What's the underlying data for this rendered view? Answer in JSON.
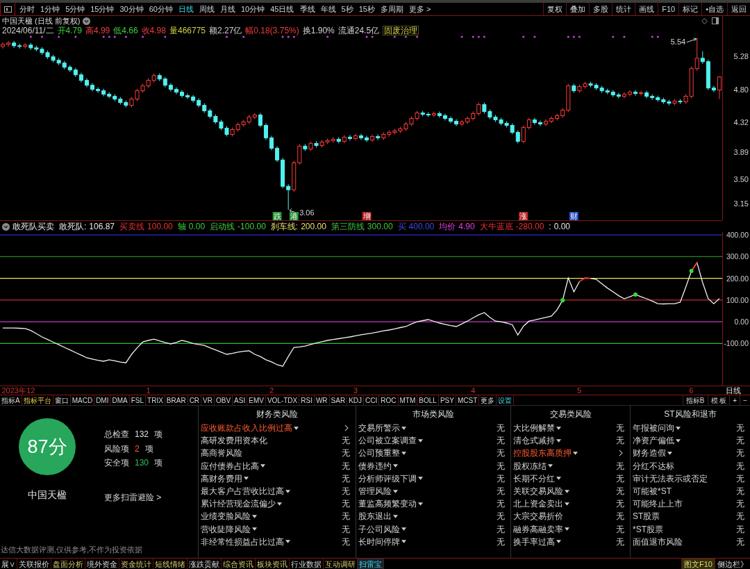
{
  "toolbar": {
    "periods": [
      {
        "label": "分时",
        "selected": false
      },
      {
        "label": "1分钟",
        "selected": false
      },
      {
        "label": "5分钟",
        "selected": false
      },
      {
        "label": "15分钟",
        "selected": false
      },
      {
        "label": "30分钟",
        "selected": false
      },
      {
        "label": "60分钟",
        "selected": false
      },
      {
        "label": "日线",
        "selected": true
      },
      {
        "label": "周线",
        "selected": false
      },
      {
        "label": "月线",
        "selected": false
      },
      {
        "label": "10分钟",
        "selected": false
      },
      {
        "label": "45日线",
        "selected": false
      },
      {
        "label": "季线",
        "selected": false
      },
      {
        "label": "年线",
        "selected": false
      },
      {
        "label": "5秒",
        "selected": false
      },
      {
        "label": "15秒",
        "selected": false
      },
      {
        "label": "多周期",
        "selected": false
      }
    ],
    "more": "更多 >",
    "actions": [
      "复权",
      "叠加",
      "多股",
      "统计",
      "画线",
      "F10",
      "标记",
      "•自选",
      "返回"
    ]
  },
  "chart_header": {
    "title": "中国天楹 (日线 前复权)",
    "date": "2024/06/11/二",
    "quote": [
      {
        "text": "开4.79",
        "color": "#3cd23c"
      },
      {
        "text": "高4.99",
        "color": "#f03a3a"
      },
      {
        "text": "低4.66",
        "color": "#3cd23c"
      },
      {
        "text": "收4.98",
        "color": "#f03a3a"
      },
      {
        "text": "量466775",
        "color": "#cfcf48"
      },
      {
        "text": "额2.27亿",
        "color": "#d4d4d4"
      },
      {
        "text": "幅0.18(3.75%)",
        "color": "#f03a3a"
      },
      {
        "text": "换1.90%",
        "color": "#d4d4d4"
      },
      {
        "text": "流通24.5亿",
        "color": "#d4d4d4"
      }
    ],
    "concept": "固废治理"
  },
  "price_pane": {
    "event_tags": [
      {
        "label": "跌",
        "color": "#1f8f2f"
      },
      {
        "label": "港",
        "color": "#1f8f2f"
      },
      {
        "label": "增",
        "color": "#b82020"
      },
      {
        "label": "涨",
        "color": "#b82020"
      },
      {
        "label": "财",
        "color": "#2850c8"
      }
    ],
    "chart_data": {
      "type": "candlestick",
      "tick_labels": "y",
      "categories": [
        null,
        null,
        null,
        null,
        null,
        null,
        null,
        null,
        null,
        null,
        null,
        null,
        null,
        null,
        null,
        null,
        null,
        null,
        null,
        null,
        null,
        null,
        null,
        null,
        null,
        null,
        null,
        null,
        null,
        null,
        null,
        null,
        null,
        null,
        null,
        null,
        null,
        null,
        null,
        null,
        null,
        null,
        null,
        null,
        null,
        null,
        null,
        null,
        null,
        null,
        null,
        null,
        null,
        null,
        null,
        null,
        null,
        null,
        null,
        null,
        null,
        null,
        null,
        null,
        null,
        null,
        null,
        null,
        null,
        null,
        null,
        null,
        null,
        null,
        null,
        null,
        null,
        null,
        null,
        null,
        null,
        null,
        null,
        null,
        null,
        null,
        null,
        null,
        null,
        null,
        null,
        null,
        null,
        null,
        null,
        null,
        null,
        null,
        null,
        null,
        null,
        null,
        null,
        null,
        null,
        null,
        null,
        null,
        null,
        null,
        null,
        null,
        null,
        null,
        null,
        null,
        null,
        null,
        null,
        null,
        null,
        null,
        null,
        null,
        null,
        null,
        null,
        null,
        null
      ],
      "ohlc": [
        [
          5.42,
          5.48,
          5.39,
          5.45
        ],
        [
          5.45,
          5.5,
          5.42,
          5.47
        ],
        [
          5.47,
          5.5,
          5.4,
          5.43
        ],
        [
          5.43,
          5.46,
          5.39,
          5.42
        ],
        [
          5.42,
          5.47,
          5.39,
          5.44
        ],
        [
          5.44,
          5.47,
          5.37,
          5.4
        ],
        [
          5.4,
          5.43,
          5.35,
          5.38
        ],
        [
          5.38,
          5.41,
          5.3,
          5.33
        ],
        [
          5.33,
          5.36,
          5.24,
          5.27
        ],
        [
          5.27,
          5.3,
          5.19,
          5.22
        ],
        [
          5.22,
          5.25,
          5.15,
          5.18
        ],
        [
          5.18,
          5.21,
          5.09,
          5.12
        ],
        [
          5.12,
          5.15,
          5.05,
          5.08
        ],
        [
          5.08,
          5.11,
          4.98,
          5.01
        ],
        [
          5.01,
          5.04,
          4.9,
          4.93
        ],
        [
          4.93,
          4.96,
          4.83,
          4.86
        ],
        [
          4.86,
          4.89,
          4.77,
          4.8
        ],
        [
          4.8,
          4.83,
          4.75,
          4.78
        ],
        [
          4.78,
          4.81,
          4.7,
          4.73
        ],
        [
          4.73,
          4.76,
          4.67,
          4.7
        ],
        [
          4.7,
          4.73,
          4.63,
          4.66
        ],
        [
          4.66,
          4.69,
          4.58,
          4.61
        ],
        [
          4.61,
          4.64,
          4.54,
          4.57
        ],
        [
          4.57,
          4.69,
          4.54,
          4.66
        ],
        [
          4.66,
          4.81,
          4.63,
          4.78
        ],
        [
          4.78,
          4.88,
          4.75,
          4.85
        ],
        [
          4.85,
          4.96,
          4.82,
          4.93
        ],
        [
          4.93,
          5.03,
          4.9,
          5.0
        ],
        [
          5.0,
          5.03,
          4.92,
          4.95
        ],
        [
          4.95,
          4.98,
          4.83,
          4.86
        ],
        [
          4.86,
          4.89,
          4.77,
          4.8
        ],
        [
          4.8,
          4.83,
          4.73,
          4.76
        ],
        [
          4.76,
          4.79,
          4.68,
          4.71
        ],
        [
          4.71,
          4.74,
          4.66,
          4.69
        ],
        [
          4.69,
          4.72,
          4.61,
          4.64
        ],
        [
          4.64,
          4.67,
          4.54,
          4.57
        ],
        [
          4.57,
          4.6,
          4.46,
          4.49
        ],
        [
          4.49,
          4.52,
          4.38,
          4.41
        ],
        [
          4.41,
          4.44,
          4.3,
          4.33
        ],
        [
          4.33,
          4.36,
          4.21,
          4.24
        ],
        [
          4.24,
          4.27,
          4.12,
          4.15
        ],
        [
          4.15,
          4.25,
          4.12,
          4.22
        ],
        [
          4.22,
          4.32,
          4.19,
          4.29
        ],
        [
          4.29,
          4.36,
          4.26,
          4.33
        ],
        [
          4.33,
          4.43,
          4.3,
          4.4
        ],
        [
          4.4,
          4.46,
          4.37,
          4.43
        ],
        [
          4.43,
          4.46,
          4.25,
          4.28
        ],
        [
          4.28,
          4.31,
          4.07,
          4.1
        ],
        [
          4.1,
          4.13,
          3.92,
          3.95
        ],
        [
          3.95,
          3.98,
          3.75,
          3.78
        ],
        [
          3.78,
          3.81,
          3.37,
          3.4
        ],
        [
          3.4,
          3.43,
          3.06,
          3.35
        ],
        [
          3.35,
          3.77,
          3.32,
          3.74
        ],
        [
          3.74,
          4.01,
          3.71,
          3.98
        ],
        [
          3.98,
          4.01,
          3.91,
          3.94
        ],
        [
          3.94,
          4.05,
          3.91,
          4.02
        ],
        [
          4.02,
          4.05,
          3.96,
          3.99
        ],
        [
          3.99,
          4.07,
          3.96,
          4.04
        ],
        [
          4.04,
          4.09,
          4.01,
          4.06
        ],
        [
          4.06,
          4.11,
          4.03,
          4.08
        ],
        [
          4.08,
          4.11,
          4.02,
          4.05
        ],
        [
          4.05,
          4.14,
          4.02,
          4.11
        ],
        [
          4.11,
          4.14,
          4.06,
          4.09
        ],
        [
          4.09,
          4.16,
          4.06,
          4.13
        ],
        [
          4.13,
          4.16,
          4.07,
          4.1
        ],
        [
          4.1,
          4.13,
          4.04,
          4.07
        ],
        [
          4.07,
          4.15,
          4.04,
          4.12
        ],
        [
          4.12,
          4.15,
          4.07,
          4.1
        ],
        [
          4.1,
          4.18,
          4.07,
          4.15
        ],
        [
          4.15,
          4.21,
          4.12,
          4.18
        ],
        [
          4.18,
          4.23,
          4.15,
          4.2
        ],
        [
          4.2,
          4.26,
          4.17,
          4.23
        ],
        [
          4.23,
          4.33,
          4.2,
          4.3
        ],
        [
          4.3,
          4.41,
          4.27,
          4.38
        ],
        [
          4.38,
          4.49,
          4.35,
          4.46
        ],
        [
          4.46,
          4.49,
          4.41,
          4.44
        ],
        [
          4.44,
          4.47,
          4.4,
          4.43
        ],
        [
          4.43,
          4.48,
          4.4,
          4.45
        ],
        [
          4.45,
          4.48,
          4.39,
          4.42
        ],
        [
          4.42,
          4.45,
          4.35,
          4.38
        ],
        [
          4.38,
          4.41,
          4.31,
          4.34
        ],
        [
          4.34,
          4.37,
          4.27,
          4.3
        ],
        [
          4.3,
          4.36,
          4.27,
          4.33
        ],
        [
          4.33,
          4.41,
          4.3,
          4.38
        ],
        [
          4.38,
          4.48,
          4.35,
          4.45
        ],
        [
          4.45,
          4.61,
          4.42,
          4.58
        ],
        [
          4.58,
          4.61,
          4.45,
          4.48
        ],
        [
          4.48,
          4.51,
          4.37,
          4.4
        ],
        [
          4.4,
          4.43,
          4.33,
          4.36
        ],
        [
          4.36,
          4.39,
          4.28,
          4.31
        ],
        [
          4.31,
          4.34,
          4.25,
          4.28
        ],
        [
          4.28,
          4.31,
          4.15,
          4.18
        ],
        [
          4.18,
          4.21,
          4.02,
          4.05
        ],
        [
          4.05,
          4.28,
          4.02,
          4.25
        ],
        [
          4.25,
          4.39,
          4.22,
          4.36
        ],
        [
          4.36,
          4.39,
          4.29,
          4.32
        ],
        [
          4.32,
          4.35,
          4.27,
          4.3
        ],
        [
          4.3,
          4.37,
          4.27,
          4.34
        ],
        [
          4.34,
          4.41,
          4.31,
          4.38
        ],
        [
          4.38,
          4.45,
          4.35,
          4.42
        ],
        [
          4.42,
          4.53,
          4.39,
          4.5
        ],
        [
          4.5,
          4.88,
          4.47,
          4.85
        ],
        [
          4.85,
          4.88,
          4.75,
          4.78
        ],
        [
          4.78,
          4.87,
          4.75,
          4.84
        ],
        [
          4.84,
          4.91,
          4.81,
          4.88
        ],
        [
          4.88,
          4.91,
          4.83,
          4.86
        ],
        [
          4.86,
          4.89,
          4.79,
          4.82
        ],
        [
          4.82,
          4.85,
          4.75,
          4.78
        ],
        [
          4.78,
          4.81,
          4.73,
          4.76
        ],
        [
          4.76,
          4.79,
          4.69,
          4.72
        ],
        [
          4.72,
          4.75,
          4.67,
          4.7
        ],
        [
          4.7,
          4.76,
          4.67,
          4.73
        ],
        [
          4.73,
          4.79,
          4.7,
          4.76
        ],
        [
          4.76,
          4.79,
          4.71,
          4.74
        ],
        [
          4.74,
          4.78,
          4.71,
          4.75
        ],
        [
          4.75,
          4.78,
          4.67,
          4.7
        ],
        [
          4.7,
          4.73,
          4.65,
          4.68
        ],
        [
          4.68,
          4.71,
          4.62,
          4.65
        ],
        [
          4.65,
          4.68,
          4.59,
          4.62
        ],
        [
          4.62,
          4.65,
          4.57,
          4.6
        ],
        [
          4.6,
          4.66,
          4.57,
          4.63
        ],
        [
          4.63,
          4.66,
          4.59,
          4.62
        ],
        [
          4.62,
          4.73,
          4.59,
          4.7
        ],
        [
          4.7,
          5.13,
          4.67,
          5.1
        ],
        [
          5.1,
          5.54,
          5.07,
          5.25
        ],
        [
          5.25,
          5.35,
          5.17,
          5.2
        ],
        [
          5.2,
          5.23,
          4.79,
          4.82
        ],
        [
          4.82,
          4.85,
          4.76,
          4.79
        ],
        [
          4.79,
          4.99,
          4.66,
          4.98
        ]
      ],
      "ylim": [
        2.91,
        5.86
      ],
      "yticks": [
        {
          "value": 5.28,
          "label": "5.28"
        },
        {
          "value": 4.8,
          "label": "4.80"
        },
        {
          "value": 4.32,
          "label": "4.32"
        },
        {
          "value": 3.89,
          "label": "3.89"
        },
        {
          "value": 3.5,
          "label": "3.50"
        },
        {
          "value": 3.15,
          "label": "3.15"
        }
      ],
      "annotations": [
        "5.54",
        "3.06"
      ]
    }
  },
  "indicator_pane": {
    "name": "敢死队买卖",
    "legend": [
      {
        "label": "敢死队:",
        "value": "106.87",
        "color": "#e6e6e6"
      },
      {
        "label": "买卖线",
        "value": "100.00",
        "color": "#e83232"
      },
      {
        "label": "轴",
        "value": "0.00",
        "color": "#3cd03c"
      },
      {
        "label": "启动线",
        "value": "-100.00",
        "color": "#3cd03c"
      },
      {
        "label": "刹车线:",
        "value": "200.00",
        "color": "#e8e070"
      },
      {
        "label": "第三防线",
        "value": "300.00",
        "color": "#3cc83c"
      },
      {
        "label": "买",
        "value": "400.00",
        "color": "#3a48e8"
      },
      {
        "label": "均价",
        "value": "4.90",
        "color": "#e040e0"
      },
      {
        "label": "大牛蓝底",
        "value": "-280.00",
        "color": "#e83232"
      },
      {
        "label": ":",
        "value": "0.00",
        "color": "#e6e6e6"
      }
    ],
    "chart_data": {
      "type": "line",
      "categories": [
        null,
        null,
        "2023年",
        null,
        null,
        "12",
        null,
        null,
        null,
        null,
        null,
        null,
        null,
        null,
        null,
        null,
        null,
        null,
        null,
        null,
        null,
        null,
        null,
        null,
        null,
        null,
        "1",
        null,
        null,
        null,
        null,
        null,
        null,
        null,
        null,
        null,
        null,
        null,
        null,
        null,
        null,
        null,
        null,
        null,
        null,
        null,
        null,
        null,
        "2",
        null,
        null,
        null,
        null,
        null,
        null,
        null,
        null,
        null,
        null,
        null,
        null,
        null,
        null,
        "3",
        null,
        null,
        null,
        null,
        null,
        null,
        null,
        null,
        null,
        null,
        null,
        null,
        null,
        null,
        null,
        null,
        null,
        null,
        null,
        null,
        "4",
        null,
        null,
        null,
        null,
        null,
        null,
        null,
        null,
        null,
        null,
        null,
        null,
        null,
        null,
        null,
        null,
        null,
        null,
        "5",
        null,
        null,
        null,
        null,
        null,
        null,
        null,
        null,
        null,
        null,
        null,
        null,
        null,
        null,
        null,
        null,
        null,
        null,
        null,
        "6",
        null,
        null,
        null,
        null,
        null
      ],
      "series": [
        {
          "color": "#f2f2f2",
          "values": [
            -29,
            -29,
            -29,
            -30,
            -31,
            -40,
            -55,
            -70,
            -82,
            -94,
            -106,
            -118,
            -130,
            -142,
            -154,
            -166,
            -172,
            -178,
            -182,
            -175,
            -180,
            -186,
            -189,
            -150,
            -120,
            -93,
            -86,
            -80,
            -88,
            -96,
            -102,
            -95,
            -86,
            -92,
            -100,
            -105,
            -109,
            -120,
            -130,
            -140,
            -150,
            -146,
            -140,
            -136,
            -134,
            -150,
            -160,
            -175,
            -185,
            -198,
            -205,
            -160,
            -118,
            -116,
            -112,
            -105,
            -98,
            -92,
            -86,
            -82,
            -78,
            -74,
            -70,
            -65,
            -60,
            -56,
            -52,
            -47,
            -42,
            -38,
            -33,
            -27,
            -22,
            -10,
            0,
            5,
            10,
            2,
            -6,
            -12,
            -18,
            -22,
            -10,
            3,
            18,
            32,
            42,
            20,
            3,
            0,
            -6,
            -14,
            -61,
            -20,
            3,
            8,
            14,
            20,
            26,
            55,
            99,
            202,
            138,
            185,
            null,
            200,
            195,
            175,
            155,
            138,
            120,
            106,
            115,
            125,
            115,
            106,
            95,
            83,
            82,
            83,
            83,
            90,
            160,
            234,
            272,
            180,
            106,
            83,
            107
          ]
        },
        {
          "type": "line",
          "color": "#ff3030",
          "values": [
            null,
            null,
            null,
            null,
            null,
            null,
            null,
            null,
            null,
            null,
            null,
            null,
            null,
            null,
            null,
            null,
            null,
            null,
            null,
            null,
            null,
            null,
            null,
            null,
            null,
            null,
            null,
            null,
            null,
            null,
            null,
            null,
            null,
            null,
            null,
            null,
            null,
            null,
            null,
            null,
            null,
            null,
            null,
            null,
            null,
            null,
            null,
            null,
            null,
            null,
            null,
            null,
            null,
            null,
            null,
            null,
            null,
            null,
            null,
            null,
            null,
            null,
            null,
            null,
            null,
            null,
            null,
            null,
            null,
            null,
            null,
            null,
            null,
            null,
            null,
            null,
            null,
            null,
            null,
            null,
            null,
            null,
            null,
            null,
            null,
            null,
            null,
            null,
            null,
            null,
            null,
            null,
            null,
            null,
            null,
            null,
            null,
            null,
            null,
            null,
            null,
            null,
            null,
            185,
            202,
            200,
            null,
            null,
            null,
            null,
            null,
            null,
            null,
            null,
            null,
            null,
            null,
            null,
            null,
            null,
            null,
            null,
            null,
            234,
            272,
            null,
            null,
            null,
            null
          ]
        },
        {
          "type": "scatter",
          "color": "#33dd33",
          "values": [
            null,
            null,
            null,
            null,
            null,
            null,
            null,
            null,
            null,
            null,
            null,
            null,
            null,
            null,
            null,
            null,
            null,
            null,
            null,
            null,
            null,
            null,
            null,
            null,
            null,
            null,
            null,
            null,
            null,
            null,
            null,
            null,
            null,
            null,
            null,
            null,
            null,
            null,
            null,
            null,
            null,
            null,
            null,
            null,
            null,
            null,
            null,
            null,
            null,
            null,
            null,
            null,
            null,
            null,
            null,
            null,
            null,
            null,
            null,
            null,
            null,
            null,
            null,
            null,
            null,
            null,
            null,
            null,
            null,
            null,
            null,
            null,
            null,
            null,
            null,
            null,
            null,
            null,
            null,
            null,
            null,
            null,
            null,
            null,
            null,
            null,
            null,
            null,
            null,
            null,
            null,
            null,
            null,
            null,
            null,
            null,
            null,
            null,
            null,
            null,
            99,
            null,
            null,
            null,
            null,
            null,
            null,
            null,
            null,
            null,
            null,
            null,
            null,
            125,
            null,
            null,
            null,
            null,
            null,
            null,
            null,
            null,
            null,
            234,
            null,
            null,
            null,
            null,
            null
          ]
        }
      ],
      "ylim": [
        -294,
        413
      ],
      "yticks": [
        {
          "value": 400,
          "label": "400.00"
        },
        {
          "value": 300,
          "label": "300.00"
        },
        {
          "value": 200,
          "label": "200.00"
        },
        {
          "value": 100,
          "label": "100.00"
        },
        {
          "value": 0,
          "label": "0.00"
        },
        {
          "value": -100,
          "label": "-100.00"
        }
      ],
      "ref_lines": [
        {
          "axis": "y",
          "value": 400,
          "color": "#2a2ad0"
        },
        {
          "axis": "y",
          "value": 300,
          "color": "#1e8a1e"
        },
        {
          "axis": "y",
          "value": 200,
          "color": "#e6e650"
        },
        {
          "axis": "y",
          "value": 100,
          "color": "#c82828"
        },
        {
          "axis": "y",
          "value": 0,
          "color": "#c040c0"
        },
        {
          "axis": "y",
          "value": -100,
          "color": "#28c028"
        }
      ]
    },
    "period": "日线"
  },
  "indicator_tabs": {
    "tabs": [
      {
        "label": "指标A",
        "kind": "window"
      },
      {
        "label": "指标平台",
        "kind": "platform"
      },
      {
        "label": "窗口",
        "kind": "window"
      },
      {
        "label": "MACD",
        "kind": "indicator"
      },
      {
        "label": "DMI",
        "kind": "indicator"
      },
      {
        "label": "DMA",
        "kind": "indicator"
      },
      {
        "label": "FSL",
        "kind": "indicator"
      },
      {
        "label": "TRIX",
        "kind": "indicator"
      },
      {
        "label": "BRAR",
        "kind": "indicator"
      },
      {
        "label": "CR",
        "kind": "indicator"
      },
      {
        "label": "VR",
        "kind": "indicator"
      },
      {
        "label": "OBV",
        "kind": "indicator"
      },
      {
        "label": "ASI",
        "kind": "indicator"
      },
      {
        "label": "EMV",
        "kind": "indicator"
      },
      {
        "label": "VOL-TDX",
        "kind": "indicator"
      },
      {
        "label": "RSI",
        "kind": "indicator"
      },
      {
        "label": "WR",
        "kind": "indicator"
      },
      {
        "label": "SAR",
        "kind": "indicator"
      },
      {
        "label": "KDJ",
        "kind": "indicator"
      },
      {
        "label": "CCI",
        "kind": "indicator"
      },
      {
        "label": "ROC",
        "kind": "indicator"
      },
      {
        "label": "MTM",
        "kind": "indicator"
      },
      {
        "label": "BOLL",
        "kind": "indicator"
      },
      {
        "label": "PSY",
        "kind": "indicator"
      },
      {
        "label": "MCST",
        "kind": "indicator"
      },
      {
        "label": "更多",
        "kind": "more"
      },
      {
        "label": "设置",
        "kind": "settings"
      }
    ],
    "right": [
      "指标B",
      "模 板",
      "+",
      "−"
    ]
  },
  "risk_panel": {
    "score": "87分",
    "company": "中国天楹",
    "stats": [
      {
        "label": "总检查",
        "value": "132",
        "unit": "项",
        "kind": "total"
      },
      {
        "label": "风险项",
        "value": "2",
        "unit": "项",
        "kind": "risk"
      },
      {
        "label": "安全项",
        "value": "130",
        "unit": "项",
        "kind": "safe"
      }
    ],
    "more_link": "更多扫雷避险 >",
    "disclaimer": "达信大数据评测,仅供参考,不作为投资依据",
    "columns": [
      {
        "title": "财务类风险",
        "items": [
          {
            "name": "应收账款占收入比例过高",
            "menu": true,
            "flagged": true
          },
          {
            "name": "高研发费用资本化",
            "menu": false,
            "flagged": false,
            "status": "无"
          },
          {
            "name": "高商誉风险",
            "menu": false,
            "flagged": false,
            "status": "无"
          },
          {
            "name": "应付债券占比高",
            "menu": true,
            "flagged": false,
            "status": "无"
          },
          {
            "name": "高财务费用",
            "menu": true,
            "flagged": false,
            "status": "无"
          },
          {
            "name": "最大客户占营收比过高",
            "menu": true,
            "flagged": false,
            "status": "无"
          },
          {
            "name": "累计经营现金流偏少",
            "menu": true,
            "flagged": false,
            "status": "无"
          },
          {
            "name": "业绩变脸风险",
            "menu": true,
            "flagged": false,
            "status": "无"
          },
          {
            "name": "营收陡降风险",
            "menu": true,
            "flagged": false,
            "status": "无"
          },
          {
            "name": "非经常性损益占比过高",
            "menu": true,
            "flagged": false,
            "status": "无"
          }
        ]
      },
      {
        "title": "市场类风险",
        "items": [
          {
            "name": "交易所警示",
            "menu": true,
            "flagged": false,
            "status": "无"
          },
          {
            "name": "公司被立案调查",
            "menu": true,
            "flagged": false,
            "status": "无"
          },
          {
            "name": "公司预重整",
            "menu": true,
            "flagged": false,
            "status": "无"
          },
          {
            "name": "债券违约",
            "menu": true,
            "flagged": false,
            "status": "无"
          },
          {
            "name": "分析师评级下调",
            "menu": true,
            "flagged": false,
            "status": "无"
          },
          {
            "name": "管理风险",
            "menu": true,
            "flagged": false,
            "status": "无"
          },
          {
            "name": "董监高频繁变动",
            "menu": true,
            "flagged": false,
            "status": "无"
          },
          {
            "name": "股东退出",
            "menu": true,
            "flagged": false,
            "status": "无"
          },
          {
            "name": "子公司风险",
            "menu": true,
            "flagged": false,
            "status": "无"
          },
          {
            "name": "长时间停牌",
            "menu": true,
            "flagged": false,
            "status": "无"
          }
        ]
      },
      {
        "title": "交易类风险",
        "items": [
          {
            "name": "大比例解禁",
            "menu": true,
            "flagged": false,
            "status": "无"
          },
          {
            "name": "清仓式减持",
            "menu": true,
            "flagged": false,
            "status": "无"
          },
          {
            "name": "控股股东高质押",
            "menu": true,
            "flagged": true
          },
          {
            "name": "股权冻结",
            "menu": true,
            "flagged": false,
            "status": "无"
          },
          {
            "name": "长期不分红",
            "menu": true,
            "flagged": false,
            "status": "无"
          },
          {
            "name": "关联交易风险",
            "menu": true,
            "flagged": false,
            "status": "无"
          },
          {
            "name": "北上资金卖出",
            "menu": true,
            "flagged": false,
            "status": "无"
          },
          {
            "name": "大宗交易折价",
            "menu": false,
            "flagged": false,
            "status": "无"
          },
          {
            "name": "融券高融卖率",
            "menu": true,
            "flagged": false,
            "status": "无"
          },
          {
            "name": "换手率过高",
            "menu": true,
            "flagged": false,
            "status": "无"
          }
        ]
      },
      {
        "title": "ST风险和退市",
        "items": [
          {
            "name": "年报被问询",
            "menu": true,
            "flagged": false,
            "status": "无"
          },
          {
            "name": "净资产偏低",
            "menu": true,
            "flagged": false,
            "status": "无"
          },
          {
            "name": "财务造假",
            "menu": true,
            "flagged": false,
            "status": "无"
          },
          {
            "name": "分红不达标",
            "menu": false,
            "flagged": false,
            "status": "无"
          },
          {
            "name": "审计无法表示或否定",
            "menu": false,
            "flagged": false,
            "status": "无"
          },
          {
            "name": "可能被*ST",
            "menu": false,
            "flagged": false,
            "status": "无"
          },
          {
            "name": "可能终止上市",
            "menu": false,
            "flagged": false,
            "status": "无"
          },
          {
            "name": "ST股票",
            "menu": false,
            "flagged": false,
            "status": "无"
          },
          {
            "name": "*ST股票",
            "menu": false,
            "flagged": false,
            "status": "无"
          },
          {
            "name": "面值退市风险",
            "menu": false,
            "flagged": false,
            "status": "无"
          }
        ]
      }
    ]
  },
  "bottom_bar": {
    "tabs": [
      {
        "label": "展∨",
        "selected": false,
        "highlight": false
      },
      {
        "label": "关联报价",
        "selected": false,
        "highlight": false
      },
      {
        "label": "盘面分析",
        "selected": false,
        "highlight": true
      },
      {
        "label": "境外资金",
        "selected": false,
        "highlight": false
      },
      {
        "label": "资金统计",
        "selected": false,
        "highlight": true
      },
      {
        "label": "短线情绪",
        "selected": false,
        "highlight": true
      },
      {
        "label": "涨跌贡献",
        "selected": false,
        "highlight": false
      },
      {
        "label": "综合资讯",
        "selected": false,
        "highlight": true
      },
      {
        "label": "板块资讯",
        "selected": false,
        "highlight": true
      },
      {
        "label": "行业数据",
        "selected": false,
        "highlight": false
      },
      {
        "label": "互动调研",
        "selected": false,
        "highlight": true
      },
      {
        "label": "扫雷宝",
        "selected": true
      }
    ],
    "side": [
      {
        "label": "图文F10",
        "kind": "f10"
      },
      {
        "label": "侧边栏》",
        "kind": "sidebar"
      }
    ]
  }
}
